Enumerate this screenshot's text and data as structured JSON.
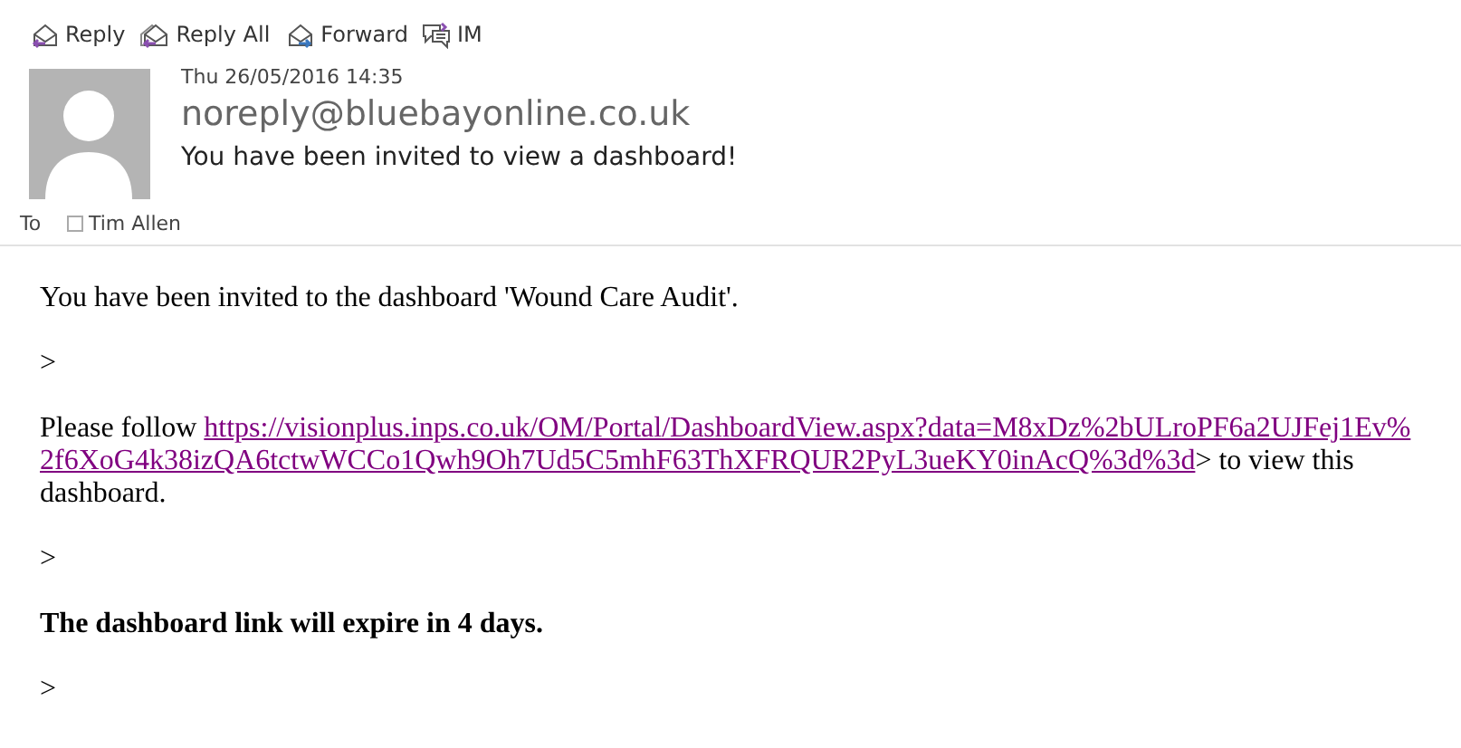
{
  "toolbar": [
    {
      "kind": "reply",
      "label": "Reply"
    },
    {
      "kind": "reply_all",
      "label": "Reply All"
    },
    {
      "kind": "forward",
      "label": "Forward"
    },
    {
      "kind": "im",
      "label": "IM"
    }
  ],
  "header": {
    "date": "Thu 26/05/2016 14:35",
    "sender": "noreply@bluebayonline.co.uk",
    "subject": "You have been invited to view a dashboard!",
    "to_label": "To",
    "recipients": [
      {
        "name": "Tim Allen",
        "checked": false
      }
    ]
  },
  "body": {
    "intro": "You have been invited to the dashboard 'Wound Care Audit'.",
    "quote1": ">",
    "follow_before": "Please follow ",
    "link_lines": [
      "https://visionplus.inps.co.uk/OM/Portal/DashboardView.aspx?data=M8xDz%2bULroPF6a2UJFej1Ev%",
      "2f6XoG4k38izQA6tctwWCCo1Qwh9Oh7Ud5C5mhF63ThXFRQUR2PyL3ueKY0inAcQ%3d%3d"
    ],
    "follow_after": "> to view this",
    "follow_end": "dashboard.",
    "quote2": ">",
    "expiry": "The dashboard link will expire in 4 days.",
    "quote3": ">"
  }
}
